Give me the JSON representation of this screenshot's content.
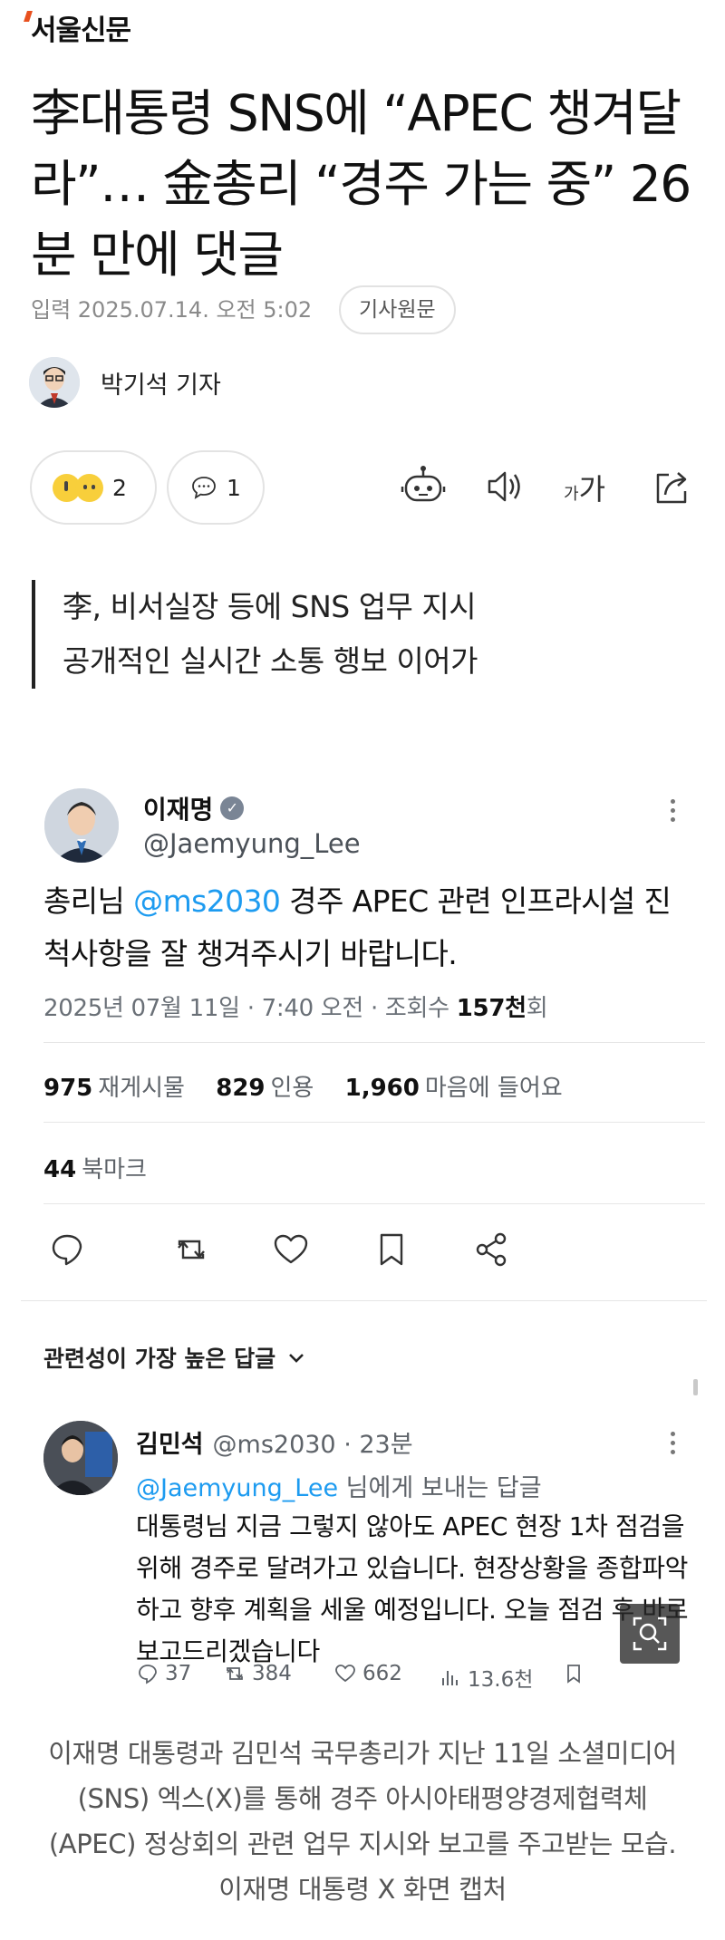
{
  "brand": {
    "name": "서울신문"
  },
  "article": {
    "headline": "李대통령 SNS에 “APEC 챙겨달라”… 金총리 “경주 가는 중” 26분 만에 댓글",
    "dateline": "입력 2025.07.14. 오전 5:02",
    "original_button": "기사원문",
    "reporter": "박기석 기자",
    "reaction_count": "2",
    "comment_count": "1",
    "font_size_label_small": "가",
    "font_size_label_large": "가",
    "subheads": [
      "李, 비서실장 등에 SNS 업무 지시",
      "공개적인 실시간 소통 행보 이어가"
    ],
    "caption": "이재명 대통령과 김민석 국무총리가 지난 11일 소셜미디어(SNS) 엑스(X)를 통해 경주 아시아태평양경제협력체(APEC) 정상회의 관련 업무 지시와 보고를 주고받는 모습.  이재명 대통령 X 화면 캡처"
  },
  "tweet": {
    "name": "이재명",
    "handle": "@Jaemyung_Lee",
    "text_prefix": "총리님 ",
    "mention": "@ms2030",
    "text_suffix": " 경주 APEC 관련 인프라시설 진척사항을 잘 챙겨주시기 바랍니다.",
    "meta_prefix": "2025년 07월 11일 · 7:40 오전 · 조회수 ",
    "views": "157천",
    "meta_suffix": "회",
    "retweets_num": "975",
    "retweets_label": "재게시물",
    "quotes_num": "829",
    "quotes_label": "인용",
    "likes_num": "1,960",
    "likes_label": "마음에 들어요",
    "bookmarks_num": "44",
    "bookmarks_label": "북마크",
    "relevance_label": "관련성이 가장 높은 답글"
  },
  "reply": {
    "name": "김민석",
    "meta": "@ms2030 · 23분",
    "to_mention": "@Jaemyung_Lee",
    "to_suffix": " 님에게 보내는 답글",
    "body": "대통령님 지금 그렇지 않아도 APEC 현장 1차 점검을 위해 경주로 달려가고 있습니다. 현장상황을 종합파악하고 향후 계획을 세울 예정입니다. 오늘 점검 후 바로 보고드리겠습니다",
    "replies": "37",
    "reposts": "384",
    "likes": "662",
    "views": "13.6천"
  },
  "colors": {
    "brand_accent": "#e8501e",
    "mention": "#1d9bf0",
    "muted": "#8a8a8a"
  },
  "icons": [
    "robot-voice-icon",
    "speaker-icon",
    "font-size-icon",
    "share-icon",
    "reply-icon",
    "retweet-icon",
    "heart-icon",
    "bookmark-icon",
    "share-nodes-icon",
    "chevron-down-icon",
    "verified-icon",
    "zoom-icon"
  ]
}
